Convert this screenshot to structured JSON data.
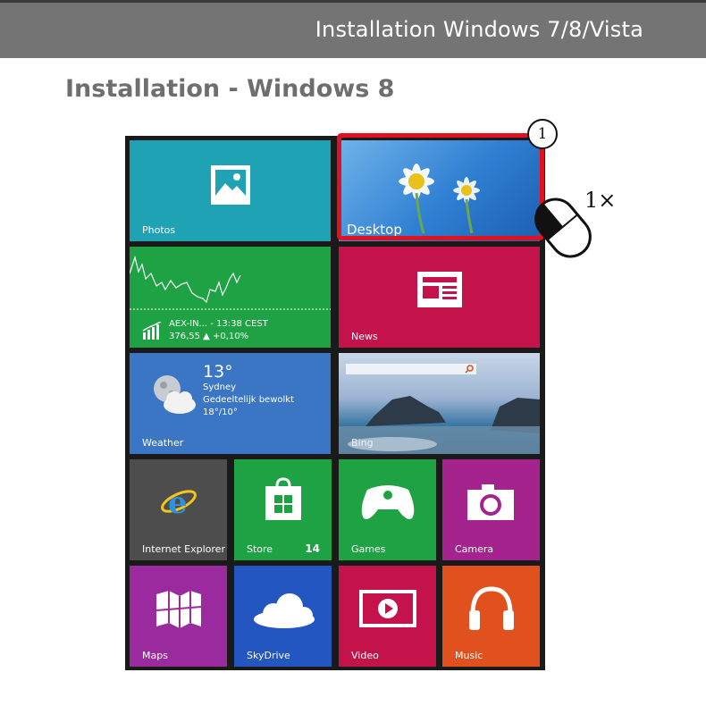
{
  "header": {
    "title": "Installation Windows 7/8/Vista"
  },
  "section": {
    "title": "Installation - Windows 8"
  },
  "tiles": {
    "photos": {
      "label": "Photos",
      "color": "#1fa3b4"
    },
    "desktop": {
      "label": "Desktop"
    },
    "finance": {
      "line1": "AEX-IN... - 13:38 CEST",
      "line2": "376,55 ▲ +0,10%",
      "color": "#1ea243"
    },
    "news": {
      "label": "News",
      "color": "#c3134a"
    },
    "weather": {
      "temp": "13°",
      "city": "Sydney",
      "condition": "Gedeeltelijk bewolkt",
      "range": "18°/10°",
      "label": "Weather",
      "color": "#3a76c4"
    },
    "bing": {
      "label": "Bing"
    },
    "ie": {
      "label": "Internet Explorer",
      "color": "#4d4d4d"
    },
    "store": {
      "label": "Store",
      "badge": "14",
      "color": "#1ea243"
    },
    "games": {
      "label": "Games",
      "color": "#1ea243"
    },
    "camera": {
      "label": "Camera",
      "color": "#a4238c"
    },
    "maps": {
      "label": "Maps",
      "color": "#9b2a9e"
    },
    "skydrive": {
      "label": "SkyDrive",
      "color": "#2356c0"
    },
    "video": {
      "label": "Video",
      "color": "#c3134a"
    },
    "music": {
      "label": "Music",
      "color": "#e0511d"
    }
  },
  "annotation": {
    "step_number": "1",
    "click_count": "1×",
    "highlight_color": "#e3111f"
  }
}
